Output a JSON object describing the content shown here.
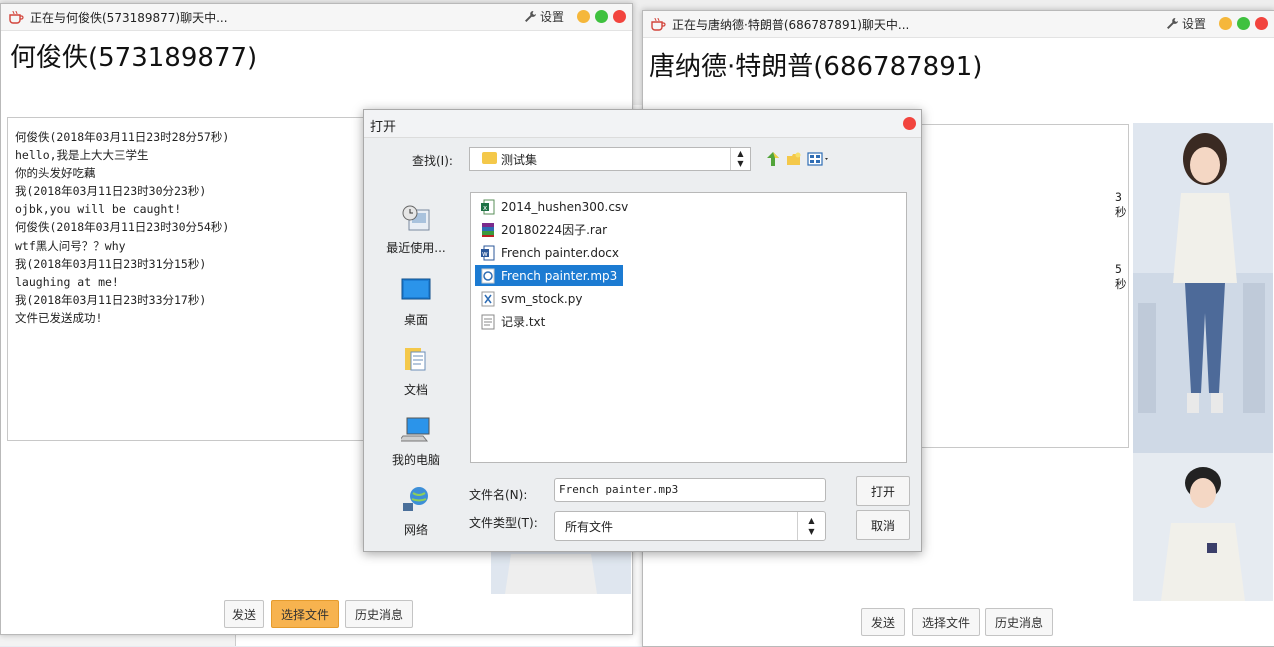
{
  "left_chat": {
    "window_title": "正在与何俊佚(573189877)聊天中...",
    "settings_label": "设置",
    "contact": "何俊佚(573189877)",
    "messages": [
      "何俊佚(2018年03月11日23时28分57秒)",
      "hello,我是上大大三学生",
      "你的头发好吃藕",
      "我(2018年03月11日23时30分23秒)",
      "ojbk,you will be caught!",
      "何俊佚(2018年03月11日23时30分54秒)",
      "wtf黑人问号？？why",
      "我(2018年03月11日23时31分15秒)",
      "laughing at me!",
      "我(2018年03月11日23时33分17秒)",
      "文件已发送成功!"
    ],
    "buttons": {
      "send": "发送",
      "choose_file": "选择文件",
      "history": "历史消息"
    }
  },
  "right_chat": {
    "window_title": "正在与唐纳德·特朗普(686787891)聊天中...",
    "settings_label": "设置",
    "contact": "唐纳德·特朗普(686787891)",
    "visible_fragments": [
      "3秒)",
      "5秒)"
    ],
    "buttons": {
      "send": "发送",
      "choose_file": "选择文件",
      "history": "历史消息"
    }
  },
  "open_dialog": {
    "title": "打开",
    "look_in_label": "查找(I):",
    "look_in_value": "测试集",
    "places": [
      "最近使用...",
      "桌面",
      "文档",
      "我的电脑",
      "网络"
    ],
    "files": [
      {
        "name": "2014_hushen300.csv",
        "icon": "excel-icon"
      },
      {
        "name": "20180224因子.rar",
        "icon": "winrar-icon"
      },
      {
        "name": "French painter.docx",
        "icon": "word-icon"
      },
      {
        "name": "French painter.mp3",
        "icon": "audio-file-icon",
        "selected": true
      },
      {
        "name": "svm_stock.py",
        "icon": "python-file-icon"
      },
      {
        "name": "记录.txt",
        "icon": "text-file-icon"
      }
    ],
    "file_name_label": "文件名(N):",
    "file_name_value": "French painter.mp3",
    "file_type_label": "文件类型(T):",
    "file_type_value": "所有文件",
    "open_button": "打开",
    "cancel_button": "取消"
  },
  "colors": {
    "selection": "#1c7bd2",
    "primary_button": "#f7b34f",
    "close": "#f2443e",
    "minimize": "#f5b73b",
    "maximize": "#3fc13f"
  }
}
